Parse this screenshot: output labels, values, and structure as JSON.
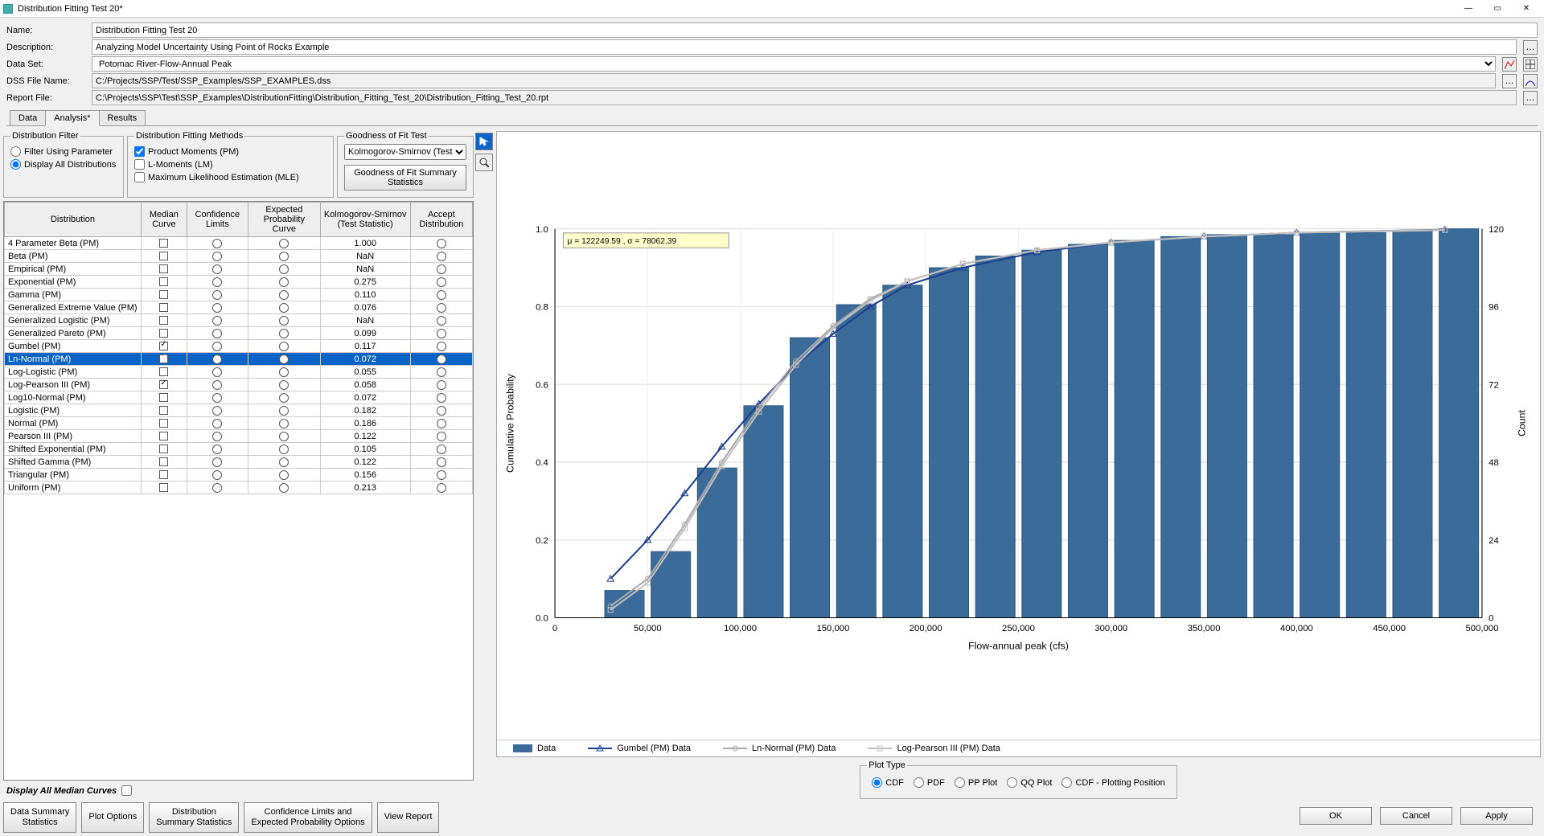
{
  "title": "Distribution Fitting Test 20*",
  "form": {
    "name_label": "Name:",
    "name": "Distribution Fitting Test 20",
    "desc_label": "Description:",
    "desc": "Analyzing Model Uncertainty Using Point of Rocks Example",
    "dataset_label": "Data Set:",
    "dataset": "Potomac River-Flow-Annual Peak",
    "dssfile_label": "DSS File Name:",
    "dssfile": "C:/Projects/SSP/Test/SSP_Examples/SSP_EXAMPLES.dss",
    "report_label": "Report File:",
    "report": "C:\\Projects\\SSP\\Test\\SSP_Examples\\DistributionFitting\\Distribution_Fitting_Test_20\\Distribution_Fitting_Test_20.rpt"
  },
  "tabs": {
    "data": "Data",
    "analysis": "Analysis*",
    "results": "Results"
  },
  "filter": {
    "legend": "Distribution Filter",
    "opt1": "Filter Using Parameter",
    "opt2": "Display All Distributions"
  },
  "methods": {
    "legend": "Distribution Fitting Methods",
    "pm": "Product Moments (PM)",
    "lm": "L-Moments (LM)",
    "mle": "Maximum Likelihood Estimation (MLE)"
  },
  "gof": {
    "legend": "Goodness of Fit Test",
    "select": "Kolmogorov-Smirnov (Test Statistic)",
    "button": "Goodness of Fit Summary Statistics"
  },
  "table": {
    "headers": [
      "Distribution",
      "Median Curve",
      "Confidence Limits",
      "Expected Probability Curve",
      "Kolmogorov-Smirnov (Test Statistic)",
      "Accept Distribution"
    ],
    "rows": [
      {
        "name": "4 Parameter Beta (PM)",
        "mc": false,
        "ks": "1.000",
        "sel": false
      },
      {
        "name": "Beta (PM)",
        "mc": false,
        "ks": "NaN",
        "sel": false
      },
      {
        "name": "Empirical (PM)",
        "mc": false,
        "ks": "NaN",
        "sel": false
      },
      {
        "name": "Exponential (PM)",
        "mc": false,
        "ks": "0.275",
        "sel": false
      },
      {
        "name": "Gamma (PM)",
        "mc": false,
        "ks": "0.110",
        "sel": false
      },
      {
        "name": "Generalized Extreme Value (PM)",
        "mc": false,
        "ks": "0.076",
        "sel": false
      },
      {
        "name": "Generalized Logistic (PM)",
        "mc": false,
        "ks": "NaN",
        "sel": false
      },
      {
        "name": "Generalized Pareto (PM)",
        "mc": false,
        "ks": "0.099",
        "sel": false
      },
      {
        "name": "Gumbel (PM)",
        "mc": true,
        "ks": "0.117",
        "sel": false
      },
      {
        "name": "Ln-Normal (PM)",
        "mc": true,
        "ks": "0.072",
        "sel": true
      },
      {
        "name": "Log-Logistic (PM)",
        "mc": false,
        "ks": "0.055",
        "sel": false
      },
      {
        "name": "Log-Pearson III (PM)",
        "mc": true,
        "ks": "0.058",
        "sel": false
      },
      {
        "name": "Log10-Normal (PM)",
        "mc": false,
        "ks": "0.072",
        "sel": false
      },
      {
        "name": "Logistic (PM)",
        "mc": false,
        "ks": "0.182",
        "sel": false
      },
      {
        "name": "Normal (PM)",
        "mc": false,
        "ks": "0.186",
        "sel": false
      },
      {
        "name": "Pearson III (PM)",
        "mc": false,
        "ks": "0.122",
        "sel": false
      },
      {
        "name": "Shifted Exponential (PM)",
        "mc": false,
        "ks": "0.105",
        "sel": false
      },
      {
        "name": "Shifted Gamma (PM)",
        "mc": false,
        "ks": "0.122",
        "sel": false
      },
      {
        "name": "Triangular (PM)",
        "mc": false,
        "ks": "0.156",
        "sel": false
      },
      {
        "name": "Uniform (PM)",
        "mc": false,
        "ks": "0.213",
        "sel": false
      }
    ]
  },
  "median_all": "Display All Median Curves",
  "actions": {
    "data_summary": "Data Summary\nStatistics",
    "plot_options": "Plot Options",
    "dist_summary": "Distribution\nSummary Statistics",
    "conf_limits": "Confidence Limits and\nExpected Probability Options",
    "view_report": "View Report"
  },
  "chart": {
    "annotation": "μ = 122249.59 , σ = 78062.39",
    "ylabel": "Cumulative Probability",
    "y2label": "Count",
    "xlabel": "Flow-annual peak (cfs)",
    "legend": {
      "data": "Data",
      "gumbel": "Gumbel (PM) Data",
      "ln": "Ln-Normal (PM) Data",
      "lp3": "Log-Pearson III (PM) Data"
    }
  },
  "plot_type": {
    "legend": "Plot Type",
    "cdf": "CDF",
    "pdf": "PDF",
    "pp": "PP Plot",
    "qq": "QQ Plot",
    "cdfpp": "CDF - Plotting Position"
  },
  "footer": {
    "ok": "OK",
    "cancel": "Cancel",
    "apply": "Apply"
  },
  "chart_data": {
    "type": "bar+line",
    "x_ticks": [
      0,
      50000,
      100000,
      150000,
      200000,
      250000,
      300000,
      350000,
      400000,
      450000,
      500000
    ],
    "y1_ticks": [
      0,
      0.2,
      0.4,
      0.6,
      0.8,
      1.0
    ],
    "y2_ticks": [
      0,
      24,
      48,
      72,
      96,
      120
    ],
    "y1_label": "Cumulative Probability",
    "y2_label": "Count",
    "x_label": "Flow-annual peak (cfs)",
    "bars_cum_prob": [
      {
        "x": 37500,
        "p": 0.07
      },
      {
        "x": 62500,
        "p": 0.17
      },
      {
        "x": 87500,
        "p": 0.385
      },
      {
        "x": 112500,
        "p": 0.545
      },
      {
        "x": 137500,
        "p": 0.72
      },
      {
        "x": 162500,
        "p": 0.805
      },
      {
        "x": 187500,
        "p": 0.855
      },
      {
        "x": 212500,
        "p": 0.9
      },
      {
        "x": 237500,
        "p": 0.93
      },
      {
        "x": 262500,
        "p": 0.945
      },
      {
        "x": 287500,
        "p": 0.96
      },
      {
        "x": 312500,
        "p": 0.97
      },
      {
        "x": 337500,
        "p": 0.98
      },
      {
        "x": 362500,
        "p": 0.985
      },
      {
        "x": 387500,
        "p": 0.985
      },
      {
        "x": 412500,
        "p": 0.99
      },
      {
        "x": 437500,
        "p": 0.99
      },
      {
        "x": 462500,
        "p": 0.995
      },
      {
        "x": 487500,
        "p": 1.0
      }
    ],
    "series": [
      {
        "name": "Gumbel (PM)",
        "color": "#1f3f8f",
        "pts": [
          [
            30000,
            0.1
          ],
          [
            50000,
            0.2
          ],
          [
            70000,
            0.32
          ],
          [
            90000,
            0.44
          ],
          [
            110000,
            0.55
          ],
          [
            130000,
            0.65
          ],
          [
            150000,
            0.73
          ],
          [
            170000,
            0.8
          ],
          [
            190000,
            0.855
          ],
          [
            220000,
            0.9
          ],
          [
            260000,
            0.94
          ],
          [
            300000,
            0.965
          ],
          [
            350000,
            0.98
          ],
          [
            400000,
            0.99
          ],
          [
            480000,
            0.998
          ]
        ]
      },
      {
        "name": "Ln-Normal (PM)",
        "color": "#a9a9a9",
        "pts": [
          [
            30000,
            0.03
          ],
          [
            50000,
            0.1
          ],
          [
            70000,
            0.24
          ],
          [
            90000,
            0.4
          ],
          [
            110000,
            0.54
          ],
          [
            130000,
            0.66
          ],
          [
            150000,
            0.75
          ],
          [
            170000,
            0.82
          ],
          [
            190000,
            0.865
          ],
          [
            220000,
            0.91
          ],
          [
            260000,
            0.945
          ],
          [
            300000,
            0.965
          ],
          [
            350000,
            0.98
          ],
          [
            400000,
            0.99
          ],
          [
            480000,
            0.997
          ]
        ]
      },
      {
        "name": "Log-Pearson III (PM)",
        "color": "#c0c0c0",
        "pts": [
          [
            30000,
            0.02
          ],
          [
            50000,
            0.09
          ],
          [
            70000,
            0.23
          ],
          [
            90000,
            0.39
          ],
          [
            110000,
            0.53
          ],
          [
            130000,
            0.65
          ],
          [
            150000,
            0.745
          ],
          [
            170000,
            0.815
          ],
          [
            190000,
            0.865
          ],
          [
            220000,
            0.91
          ],
          [
            260000,
            0.945
          ],
          [
            300000,
            0.965
          ],
          [
            350000,
            0.98
          ],
          [
            400000,
            0.99
          ],
          [
            480000,
            0.997
          ]
        ]
      }
    ]
  }
}
